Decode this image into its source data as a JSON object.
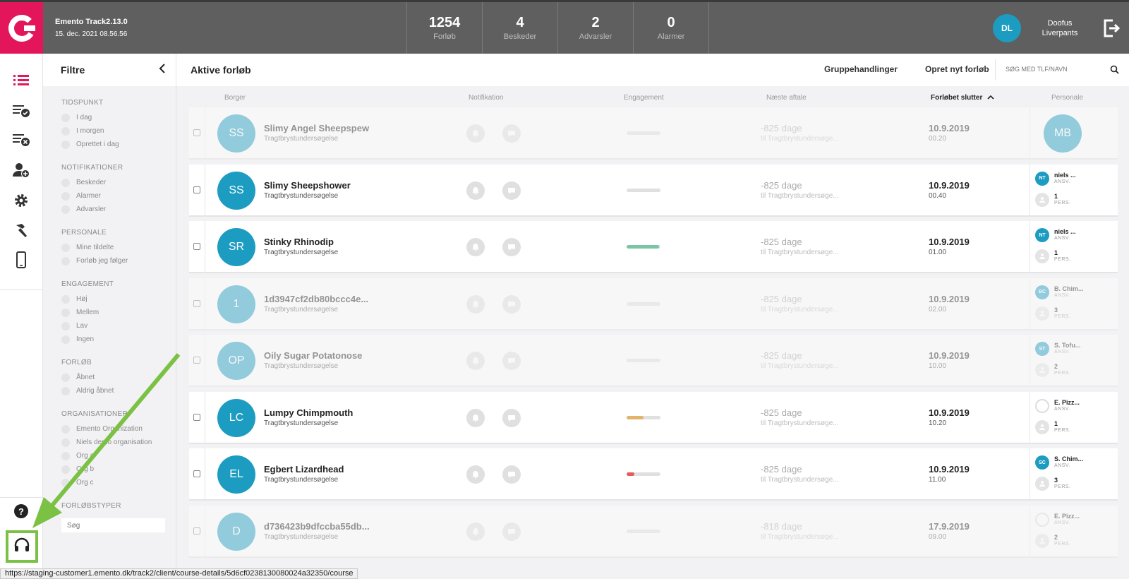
{
  "app": {
    "title": "Emento Track2.13.0",
    "datetime": "15. dec. 2021 08.56.56",
    "brand_color": "#e3165b",
    "accent_color": "#1d9cc1"
  },
  "stats": [
    {
      "value": "1254",
      "label": "Forløb"
    },
    {
      "value": "4",
      "label": "Beskeder"
    },
    {
      "value": "2",
      "label": "Advarsler"
    },
    {
      "value": "0",
      "label": "Alarmer"
    }
  ],
  "user": {
    "initials": "DL",
    "name": "Doofus Liverpants"
  },
  "rail": [
    "list-icon",
    "list-check-icon",
    "list-remove-icon",
    "add-user-icon",
    "gear-icon",
    "hammer-icon",
    "mobile-phone-icon",
    "help-icon",
    "headset-icon"
  ],
  "filters": {
    "title": "Filtre",
    "groups": [
      {
        "heading": "TIDSPUNKT",
        "options": [
          "I dag",
          "I morgen",
          "Oprettet i dag"
        ]
      },
      {
        "heading": "NOTIFIKATIONER",
        "options": [
          "Beskeder",
          "Alarmer",
          "Advarsler"
        ]
      },
      {
        "heading": "PERSONALE",
        "options": [
          "Mine tildelte",
          "Forløb jeg følger"
        ]
      },
      {
        "heading": "ENGAGEMENT",
        "options": [
          "Høj",
          "Mellem",
          "Lav",
          "Ingen"
        ]
      },
      {
        "heading": "FORLØB",
        "options": [
          "Åbnet",
          "Aldrig åbnet"
        ]
      },
      {
        "heading": "ORGANISATIONER",
        "options": [
          "Emento Organization",
          "Niels demo organisation",
          "Org a",
          "Org b",
          "Org c"
        ]
      }
    ],
    "types_heading": "FORLØBSTYPER",
    "types_search_placeholder": "Søg"
  },
  "main": {
    "title": "Aktive forløb",
    "group_actions": "Gruppehandlinger",
    "new_course": "Opret nyt forløb",
    "search_placeholder": "SØG MED TLF/NAVN",
    "columns": {
      "citizen": "Borger",
      "notification": "Notifikation",
      "engagement": "Engagement",
      "next": "Næste aftale",
      "ends": "Forløbet slutter",
      "staff": "Personale"
    }
  },
  "rows": [
    {
      "initials": "SS",
      "name": "Slimy Angel Sheepspew",
      "type": "Tragtbrystundersøgelse",
      "engagement": 0,
      "eng_color": "#e0e0e0",
      "next": "-825 dage",
      "next_sub": "til Tragtbrystundersøge...",
      "end_date": "10.9.2019",
      "end_time": "00.20",
      "dim": true,
      "staff_single": "MB"
    },
    {
      "initials": "SS",
      "name": "Slimy Sheepshower",
      "type": "Tragtbrystundersøgelse",
      "engagement": 0,
      "eng_color": "#e0e0e0",
      "next": "-825 dage",
      "next_sub": "til Tragtbrystundersøge...",
      "end_date": "10.9.2019",
      "end_time": "00.40",
      "dim": false,
      "staff_initials": "NT",
      "staff_name": "niels ...",
      "staff_role": "ANSV.",
      "pers_count": "1",
      "pers_label": "PERS."
    },
    {
      "initials": "SR",
      "name": "Stinky Rhinodip",
      "type": "Tragtbrystundersøgelse",
      "engagement": 0.95,
      "eng_color": "#7bc4a4",
      "next": "-825 dage",
      "next_sub": "til Tragtbrystundersøge...",
      "end_date": "10.9.2019",
      "end_time": "01.00",
      "dim": false,
      "staff_initials": "NT",
      "staff_name": "niels ...",
      "staff_role": "ANSV.",
      "pers_count": "1",
      "pers_label": "PERS."
    },
    {
      "initials": "1",
      "name": "1d3947cf2db80bccc4e...",
      "type": "Tragtbrystundersøgelse",
      "engagement": 0,
      "eng_color": "#e0e0e0",
      "next": "-825 dage",
      "next_sub": "til Tragtbrystundersøge...",
      "end_date": "10.9.2019",
      "end_time": "02.00",
      "dim": true,
      "staff_initials": "BC",
      "staff_name": "B. Chim...",
      "staff_role": "ANSV.",
      "pers_count": "3",
      "pers_label": "PERS."
    },
    {
      "initials": "OP",
      "name": "Oily Sugar Potatonose",
      "type": "Tragtbrystundersøgelse",
      "engagement": 0,
      "eng_color": "#e0e0e0",
      "next": "-825 dage",
      "next_sub": "til Tragtbrystundersøge...",
      "end_date": "10.9.2019",
      "end_time": "10.00",
      "dim": true,
      "staff_initials": "ST",
      "staff_name": "S. Tofu...",
      "staff_role": "ANSV.",
      "pers_count": "2",
      "pers_label": "PERS."
    },
    {
      "initials": "LC",
      "name": "Lumpy Chimpmouth",
      "type": "Tragtbrystundersøgelse",
      "engagement": 0.5,
      "eng_color": "#e2b36a",
      "next": "-825 dage",
      "next_sub": "til Tragtbrystundersøge...",
      "end_date": "10.9.2019",
      "end_time": "10.20",
      "dim": false,
      "staff_initials": "",
      "staff_name": "E. Pizz...",
      "staff_role": "ANSV.",
      "pers_count": "1",
      "pers_label": "PERS."
    },
    {
      "initials": "EL",
      "name": "Egbert Lizardhead",
      "type": "Tragtbrystundersøgelse",
      "engagement": 0.22,
      "eng_color": "#e85a5a",
      "next": "-825 dage",
      "next_sub": "til Tragtbrystundersøge...",
      "end_date": "10.9.2019",
      "end_time": "11.00",
      "dim": false,
      "staff_initials": "SC",
      "staff_name": "S. Chim...",
      "staff_role": "ANSV.",
      "pers_count": "3",
      "pers_label": "PERS."
    },
    {
      "initials": "D",
      "name": "d736423b9dfccba55db...",
      "type": "Tragtbrystundersøgelse",
      "engagement": 0,
      "eng_color": "#e0e0e0",
      "next": "-818 dage",
      "next_sub": "til Tragtbrystundersøge...",
      "end_date": "17.9.2019",
      "end_time": "09.00",
      "dim": true,
      "staff_initials": "",
      "staff_name": "E. Pizz...",
      "staff_role": "ANSV.",
      "pers_count": "2",
      "pers_label": "PERS."
    }
  ],
  "status_url": "https://staging-customer1.emento.dk/track2/client/course-details/5d6cf0238130080024a32350/course"
}
